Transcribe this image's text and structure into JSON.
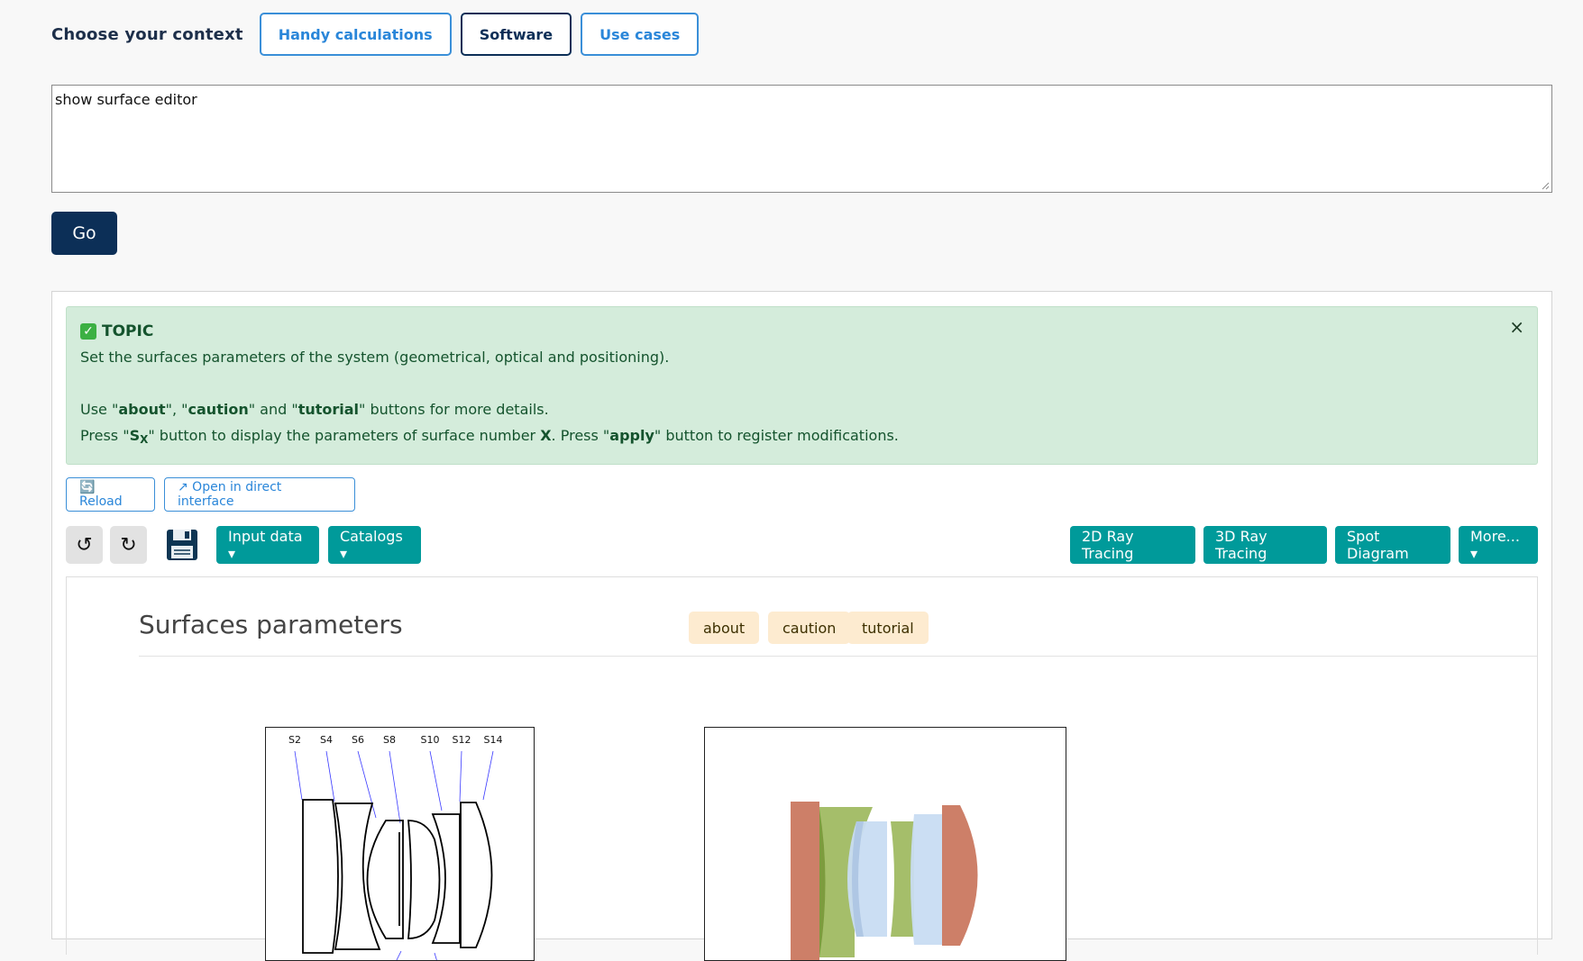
{
  "context": {
    "label": "Choose your context",
    "buttons": [
      "Handy calculations",
      "Software",
      "Use cases"
    ],
    "active": "Software"
  },
  "query": {
    "value": "show surface editor"
  },
  "go_label": "Go",
  "topic": {
    "title": "TOPIC",
    "line1": "Set the surfaces parameters of the system (geometrical, optical and positioning).",
    "line2": {
      "pre": "Use \"",
      "about": "about",
      "mid1": "\", \"",
      "caution": "caution",
      "mid2": "\" and \"",
      "tutorial": "tutorial",
      "post": "\" buttons for more details."
    },
    "line3": {
      "pre": "Press \"",
      "s": "S",
      "sub": "X",
      "mid1": "\" button to display the parameters of surface number ",
      "x": "X",
      "mid2": ". Press \"",
      "apply": "apply",
      "post": "\" button to register modifications."
    },
    "close": "×"
  },
  "utility": {
    "reload": "🔄 Reload",
    "open_direct": "↗ Open in direct interface"
  },
  "toolbar": {
    "undo": "↺",
    "redo": "↻",
    "input_data": "Input data ▾",
    "catalogs": "Catalogs ▾",
    "ray2d": "2D Ray Tracing",
    "ray3d": "3D Ray Tracing",
    "spot": "Spot Diagram",
    "more": "More... ▾"
  },
  "section": {
    "title": "Surfaces parameters",
    "tags": [
      "about",
      "caution",
      "tutorial"
    ]
  },
  "diagram": {
    "surface_labels": [
      "S2",
      "S4",
      "S6",
      "S8",
      "S10",
      "S12",
      "S14"
    ]
  },
  "colors": {
    "navy": "#0c2f57",
    "accent": "#2a86d9",
    "teal": "#009a9a",
    "topic_bg": "#d4ecdb",
    "tag_bg": "#fdebd0",
    "lens_red": "#cd7f68",
    "lens_green": "#9bb75a",
    "lens_blue": "#c8dcf2"
  }
}
